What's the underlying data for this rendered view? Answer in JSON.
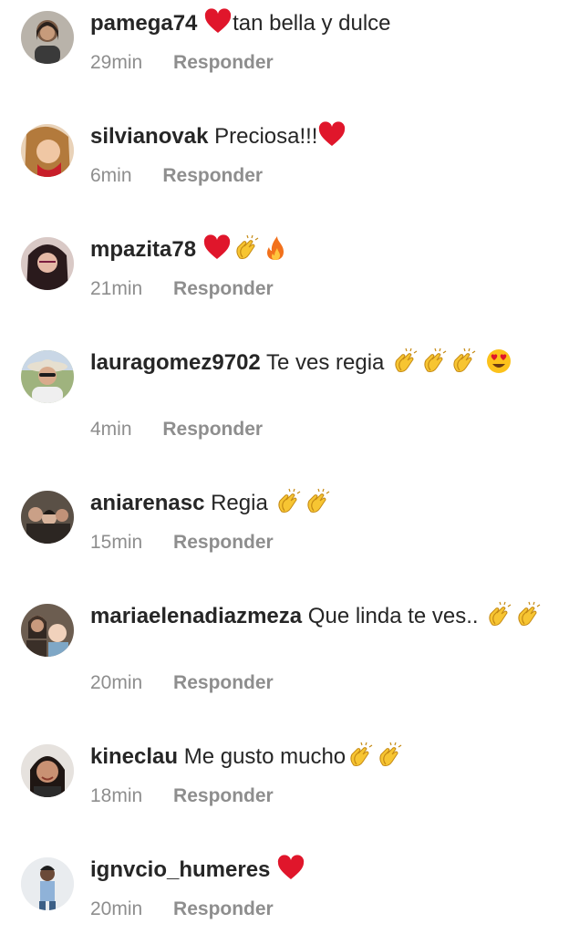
{
  "comments": [
    {
      "username": "pamega74",
      "text_before": "",
      "text_after": "tan bella y dulce",
      "emojis_before": [
        "red-heart"
      ],
      "emojis_after": [],
      "time": "29min",
      "reply": "Responder"
    },
    {
      "username": "silvianovak",
      "text_before": "Preciosa!!!",
      "emojis_before": [
        "red-heart"
      ],
      "time": "6min",
      "reply": "Responder"
    },
    {
      "username": "mpazita78",
      "text_before": "",
      "emojis_before": [
        "red-heart",
        "clapping-hands",
        "fire"
      ],
      "time": "21min",
      "reply": "Responder"
    },
    {
      "username": "lauragomez9702",
      "text_before": "Te ves regia",
      "emojis_before": [
        "clapping-hands",
        "clapping-hands",
        "clapping-hands",
        "heart-eyes"
      ],
      "time": "4min",
      "reply": "Responder"
    },
    {
      "username": "aniarenasc",
      "text_before": "Regia",
      "emojis_before": [
        "clapping-hands",
        "clapping-hands"
      ],
      "time": "15min",
      "reply": "Responder"
    },
    {
      "username": "mariaelenadiazmeza",
      "text_before": "Que linda te ves..",
      "emojis_before": [
        "clapping-hands",
        "clapping-hands"
      ],
      "time": "20min",
      "reply": "Responder"
    },
    {
      "username": "kineclau",
      "text_before": "Me gusto mucho",
      "emojis_before": [
        "clapping-hands",
        "clapping-hands"
      ],
      "time": "18min",
      "reply": "Responder"
    },
    {
      "username": "ignvcio_humeres",
      "text_before": "",
      "emojis_before": [
        "red-heart"
      ],
      "time": "20min",
      "reply": "Responder"
    }
  ],
  "colors": {
    "text": "#262626",
    "meta": "#8e8e8e",
    "heart": "#e0162b",
    "clap": "#f7c532"
  }
}
